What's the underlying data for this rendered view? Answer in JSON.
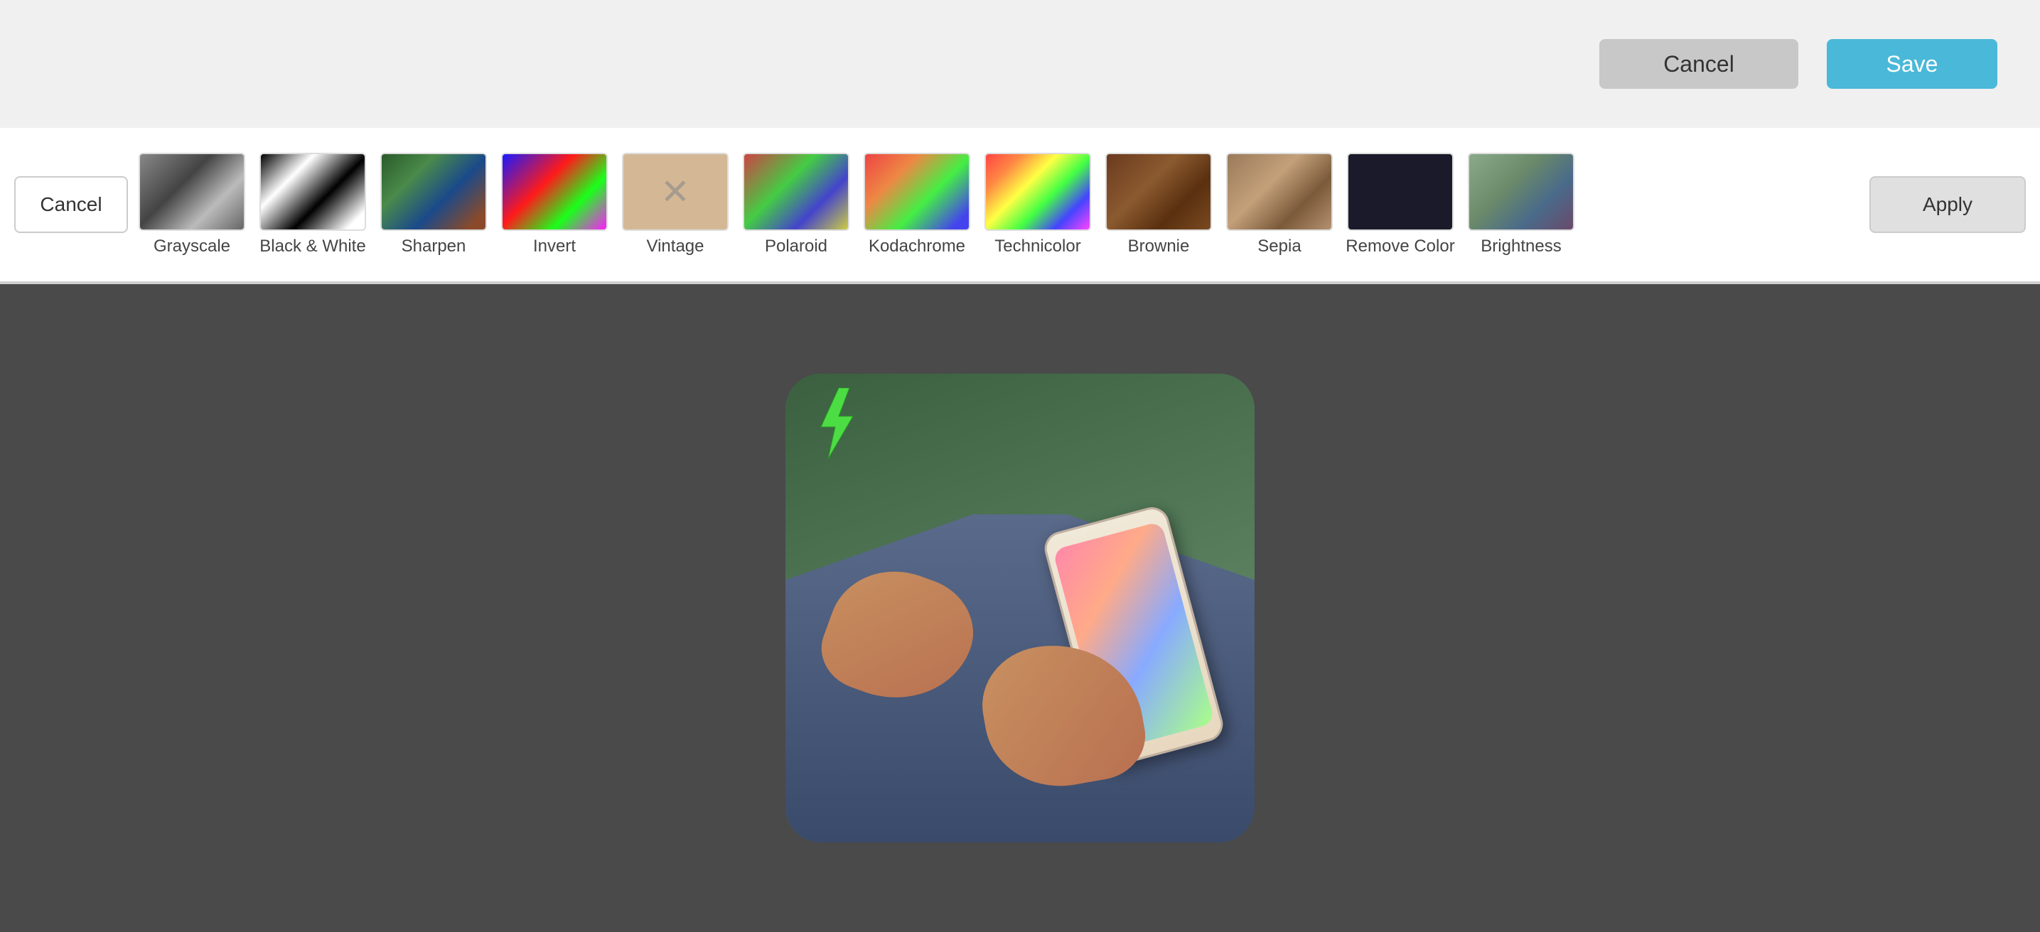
{
  "topBar": {
    "cancelLabel": "Cancel",
    "saveLabel": "Save"
  },
  "filterStrip": {
    "cancelLabel": "Cancel",
    "applyLabel": "Apply",
    "filters": [
      {
        "id": "grayscale",
        "label": "Grayscale",
        "thumbClass": "thumb-grayscale"
      },
      {
        "id": "bw",
        "label": "Black & White",
        "thumbClass": "thumb-bw"
      },
      {
        "id": "sharpen",
        "label": "Sharpen",
        "thumbClass": "thumb-sharpen"
      },
      {
        "id": "invert",
        "label": "Invert",
        "thumbClass": "thumb-invert"
      },
      {
        "id": "vintage",
        "label": "Vintage",
        "thumbClass": "thumb-vintage"
      },
      {
        "id": "polaroid",
        "label": "Polaroid",
        "thumbClass": "thumb-polaroid"
      },
      {
        "id": "kodachrome",
        "label": "Kodachrome",
        "thumbClass": "thumb-kodachrome"
      },
      {
        "id": "technicolor",
        "label": "Technicolor",
        "thumbClass": "thumb-technicolor"
      },
      {
        "id": "brownie",
        "label": "Brownie",
        "thumbClass": "thumb-brownie"
      },
      {
        "id": "sepia",
        "label": "Sepia",
        "thumbClass": "thumb-sepia"
      },
      {
        "id": "remove-color",
        "label": "Remove Color",
        "thumbClass": "thumb-remove-color"
      },
      {
        "id": "brightness",
        "label": "Brightness",
        "thumbClass": "thumb-brightness"
      }
    ]
  },
  "canvas": {
    "imageAlt": "Person holding phone"
  }
}
